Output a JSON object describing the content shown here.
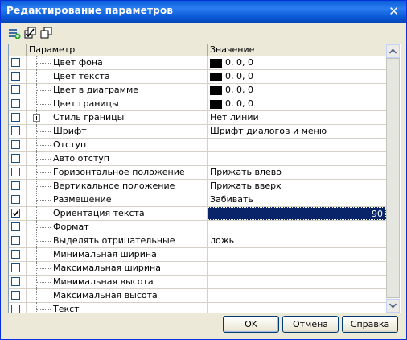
{
  "window": {
    "title": "Редактирование параметров",
    "close_glyph": "✕"
  },
  "toolbar": {
    "buttons": [
      {
        "icon": "add-row-icon"
      },
      {
        "icon": "check-all-icon"
      },
      {
        "icon": "copy-icon"
      }
    ]
  },
  "grid": {
    "headers": {
      "param": "Параметр",
      "value": "Значение"
    },
    "rows": [
      {
        "checked": false,
        "label": "Цвет фона",
        "value": "0, 0, 0",
        "swatch": "#000000"
      },
      {
        "checked": false,
        "label": "Цвет текста",
        "value": "0, 0, 0",
        "swatch": "#000000"
      },
      {
        "checked": false,
        "label": "Цвет в диаграмме",
        "value": "0, 0, 0",
        "swatch": "#000000"
      },
      {
        "checked": false,
        "label": "Цвет границы",
        "value": "0, 0, 0",
        "swatch": "#000000"
      },
      {
        "checked": false,
        "label": "Стиль границы",
        "value": "Нет линии",
        "expandable": true
      },
      {
        "checked": false,
        "label": "Шрифт",
        "value": "Шрифт диалогов и меню"
      },
      {
        "checked": false,
        "label": "Отступ",
        "value": ""
      },
      {
        "checked": false,
        "label": "Авто отступ",
        "value": ""
      },
      {
        "checked": false,
        "label": "Горизонтальное положение",
        "value": "Прижать влево"
      },
      {
        "checked": false,
        "label": "Вертикальное положение",
        "value": "Прижать вверх"
      },
      {
        "checked": false,
        "label": "Размещение",
        "value": "Забивать"
      },
      {
        "checked": true,
        "label": "Ориентация текста",
        "value": "90",
        "selected": true
      },
      {
        "checked": false,
        "label": "Формат",
        "value": ""
      },
      {
        "checked": false,
        "label": "Выделять отрицательные",
        "value": "ложь"
      },
      {
        "checked": false,
        "label": "Минимальная ширина",
        "value": ""
      },
      {
        "checked": false,
        "label": "Максимальная ширина",
        "value": ""
      },
      {
        "checked": false,
        "label": "Минимальная высота",
        "value": ""
      },
      {
        "checked": false,
        "label": "Максимальная высота",
        "value": ""
      },
      {
        "checked": false,
        "label": "Текст",
        "value": ""
      }
    ]
  },
  "buttons": {
    "ok": "OK",
    "cancel": "Отмена",
    "help": "Справка"
  },
  "colors": {
    "title_bar": "#0a5fd8",
    "selection": "#0a246a",
    "dialog_bg": "#ece9d8"
  }
}
